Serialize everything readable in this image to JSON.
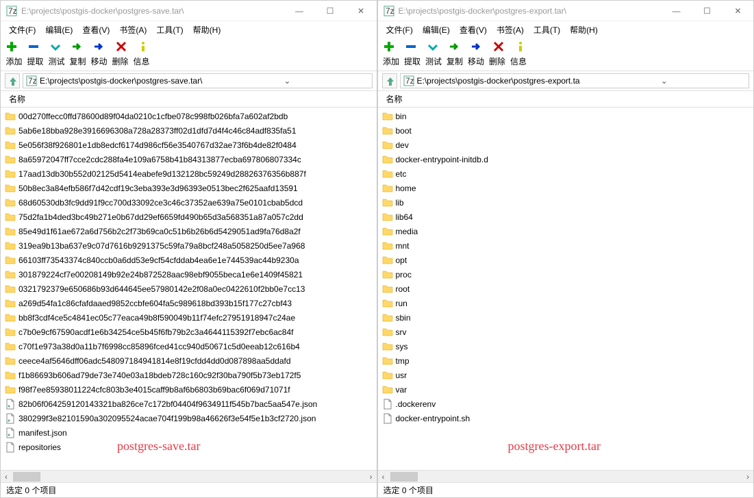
{
  "left": {
    "title": "E:\\projects\\postgis-docker\\postgres-save.tar\\",
    "menu": [
      "文件(F)",
      "编辑(E)",
      "查看(V)",
      "书签(A)",
      "工具(T)",
      "帮助(H)"
    ],
    "toolbar_labels": [
      "添加",
      "提取",
      "测试",
      "复制",
      "移动",
      "删除",
      "信息"
    ],
    "address": "E:\\projects\\postgis-docker\\postgres-save.tar\\",
    "column_header": "名称",
    "files": [
      {
        "name": "00d270ffecc0ffd78600d89f04da0210c1cfbe078c998fb026bfa7a602af2bdb",
        "type": "folder"
      },
      {
        "name": "5ab6e18bba928e3916696308a728a28373ff02d1dfd7d4f4c46c84adf835fa51",
        "type": "folder"
      },
      {
        "name": "5e056f38f926801e1db8edcf6174d986cf56e3540767d32ae73f6b4de82f0484",
        "type": "folder"
      },
      {
        "name": "8a65972047ff7cce2cdc288fa4e109a6758b41b84313877ecba697806807334c",
        "type": "folder"
      },
      {
        "name": "17aad13db30b552d02125d5414eabefe9d132128bc59249d28826376356b887f",
        "type": "folder"
      },
      {
        "name": "50b8ec3a84efb586f7d42cdf19c3eba393e3d96393e0513bec2f625aafd13591",
        "type": "folder"
      },
      {
        "name": "68d60530db3fc9dd91f9cc700d33092ce3c46c37352ae639a75e0101cbab5dcd",
        "type": "folder"
      },
      {
        "name": "75d2fa1b4ded3bc49b271e0b67dd29ef6659fd490b65d3a568351a87a057c2dd",
        "type": "folder"
      },
      {
        "name": "85e49d1f61ae672a6d756b2c2f73b69ca0c51b6b26b6d5429051ad9fa76d8a2f",
        "type": "folder"
      },
      {
        "name": "319ea9b13ba637e9c07d7616b9291375c59fa79a8bcf248a5058250d5ee7a968",
        "type": "folder"
      },
      {
        "name": "66103ff73543374c840ccb0a6dd53e9cf54cfddab4ea6e1e744539ac44b9230a",
        "type": "folder"
      },
      {
        "name": "301879224cf7e00208149b92e24b872528aac98ebf9055beca1e6e1409f45821",
        "type": "folder"
      },
      {
        "name": "0321792379e650686b93d644645ee57980142e2f08a0ec0422610f2bb0e7cc13",
        "type": "folder"
      },
      {
        "name": "a269d54fa1c86cfafdaaed9852ccbfe604fa5c989618bd393b15f177c27cbf43",
        "type": "folder"
      },
      {
        "name": "bb8f3cdf4ce5c4841ec05c77eaca49b8f590049b11f74efc27951918947c24ae",
        "type": "folder"
      },
      {
        "name": "c7b0e9cf67590acdf1e6b34254ce5b45f6fb79b2c3a4644115392f7ebc6ac84f",
        "type": "folder"
      },
      {
        "name": "c70f1e973a38d0a11b7f6998cc85896fced41cc940d50671c5d0eeab12c616b4",
        "type": "folder"
      },
      {
        "name": "ceece4af5646dff06adc548097184941814e8f19cfdd4dd0d087898aa5ddafd",
        "type": "folder"
      },
      {
        "name": "f1b86693b606ad79de73e740e03a18bdeb728c160c92f30ba790f5b73eb172f5",
        "type": "folder"
      },
      {
        "name": "f98f7ee85938011224cfc803b3e4015caff9b8af6b6803b69bac6f069d71071f",
        "type": "folder"
      },
      {
        "name": "82b06f064259120143321ba826ce7c172bf04404f9634911f545b7bac5aa547e.json",
        "type": "json"
      },
      {
        "name": "380299f3e82101590a302095524acae704f199b98a46626f3e54f5e1b3cf2720.json",
        "type": "json"
      },
      {
        "name": "manifest.json",
        "type": "json"
      },
      {
        "name": "repositories",
        "type": "file"
      }
    ],
    "status": "选定 0 个项目",
    "caption": "postgres-save.tar"
  },
  "right": {
    "title": "E:\\projects\\postgis-docker\\postgres-export.tar\\",
    "menu": [
      "文件(F)",
      "编辑(E)",
      "查看(V)",
      "书签(A)",
      "工具(T)",
      "帮助(H)"
    ],
    "toolbar_labels": [
      "添加",
      "提取",
      "测试",
      "复制",
      "移动",
      "删除",
      "信息"
    ],
    "address": "E:\\projects\\postgis-docker\\postgres-export.tar\\",
    "column_header": "名称",
    "files": [
      {
        "name": "bin",
        "type": "folder"
      },
      {
        "name": "boot",
        "type": "folder"
      },
      {
        "name": "dev",
        "type": "folder"
      },
      {
        "name": "docker-entrypoint-initdb.d",
        "type": "folder"
      },
      {
        "name": "etc",
        "type": "folder"
      },
      {
        "name": "home",
        "type": "folder"
      },
      {
        "name": "lib",
        "type": "folder"
      },
      {
        "name": "lib64",
        "type": "folder"
      },
      {
        "name": "media",
        "type": "folder"
      },
      {
        "name": "mnt",
        "type": "folder"
      },
      {
        "name": "opt",
        "type": "folder"
      },
      {
        "name": "proc",
        "type": "folder"
      },
      {
        "name": "root",
        "type": "folder"
      },
      {
        "name": "run",
        "type": "folder"
      },
      {
        "name": "sbin",
        "type": "folder"
      },
      {
        "name": "srv",
        "type": "folder"
      },
      {
        "name": "sys",
        "type": "folder"
      },
      {
        "name": "tmp",
        "type": "folder"
      },
      {
        "name": "usr",
        "type": "folder"
      },
      {
        "name": "var",
        "type": "folder"
      },
      {
        "name": ".dockerenv",
        "type": "file"
      },
      {
        "name": "docker-entrypoint.sh",
        "type": "file"
      }
    ],
    "status": "选定 0 个项目",
    "caption": "postgres-export.tar"
  }
}
